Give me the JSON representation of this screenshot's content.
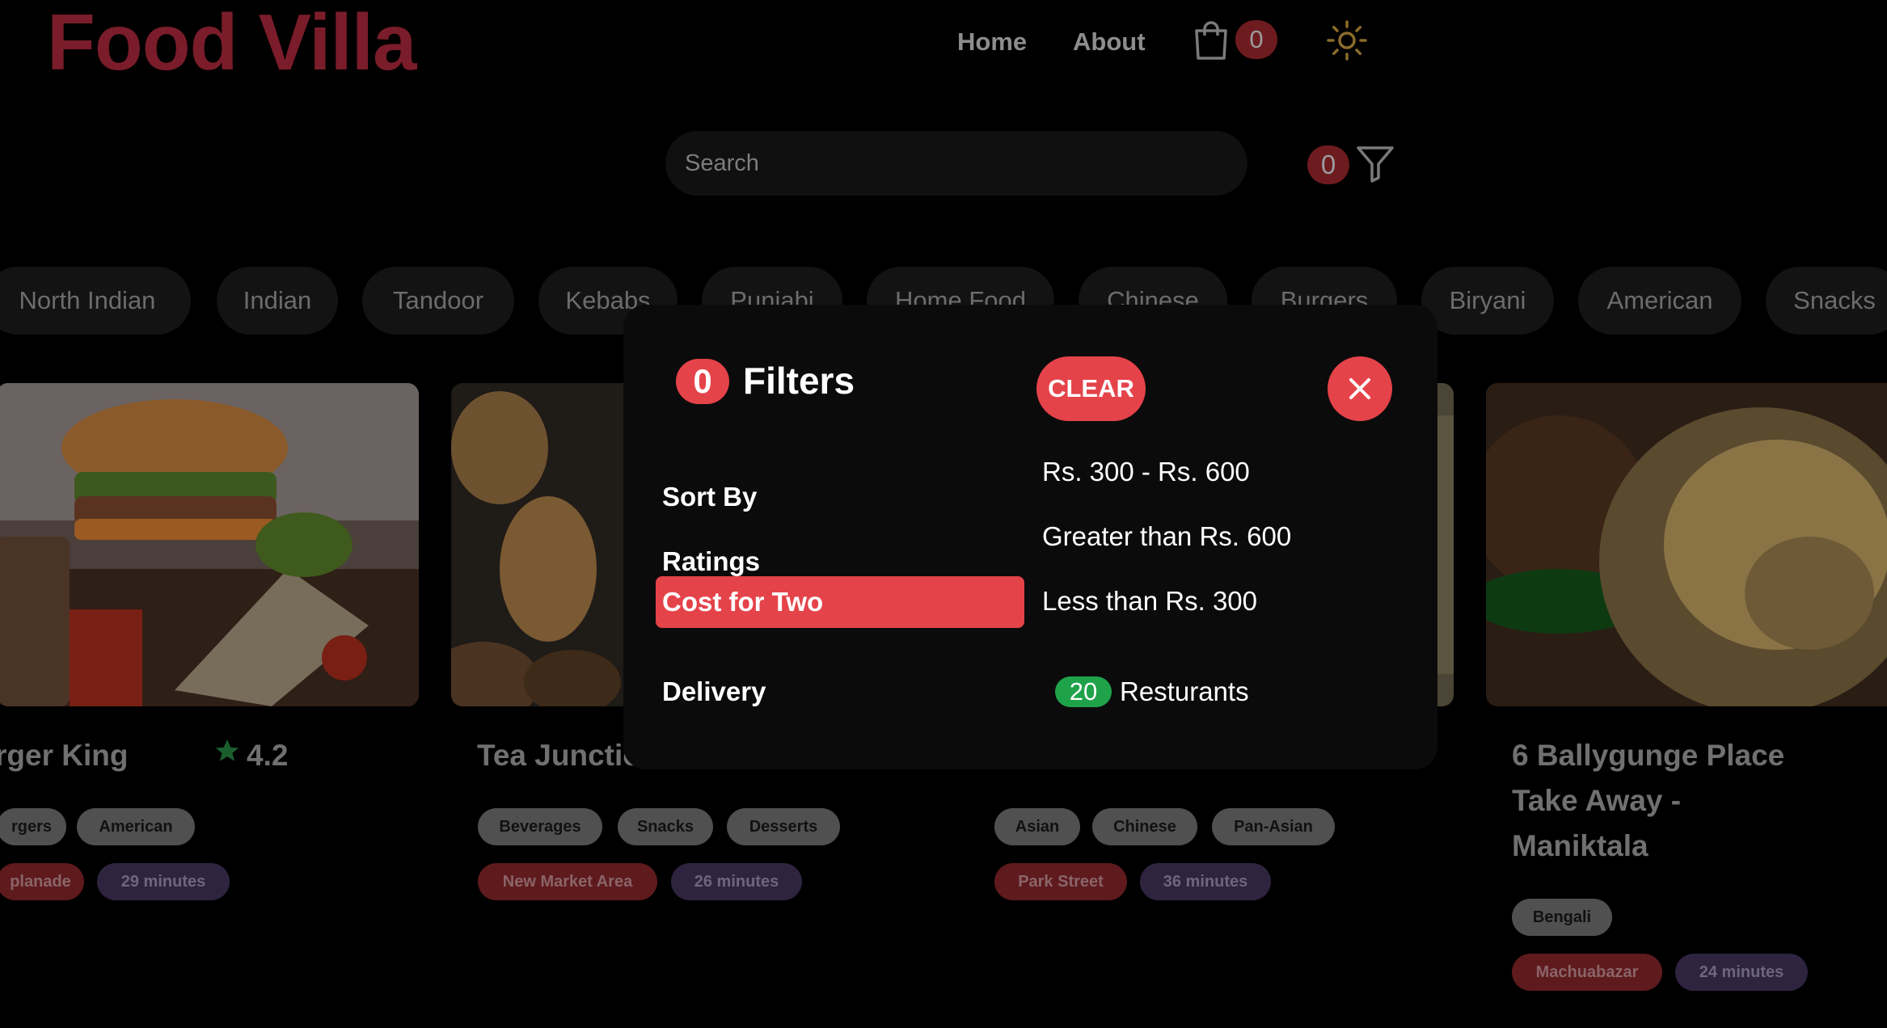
{
  "header": {
    "logo": "Food Villa",
    "nav": [
      "Home",
      "About"
    ],
    "cart_count": "0"
  },
  "search": {
    "placeholder": "Search"
  },
  "filter_count": "0",
  "cuisines": [
    "North Indian",
    "Indian",
    "Tandoor",
    "Kebabs",
    "Punjabi",
    "Home Food",
    "Chinese",
    "Burgers",
    "Biryani",
    "American",
    "Snacks"
  ],
  "cards": [
    {
      "title": "rger King",
      "rating": "4.2",
      "tags": [
        "rgers",
        "American"
      ],
      "area": "planade",
      "time": "29 minutes"
    },
    {
      "title": "Tea Junctio",
      "tags": [
        "Beverages",
        "Snacks",
        "Desserts"
      ],
      "area": "New Market Area",
      "time": "26 minutes"
    },
    {
      "tags": [
        "Asian",
        "Chinese",
        "Pan-Asian"
      ],
      "area": "Park Street",
      "time": "36 minutes"
    },
    {
      "title_lines": [
        "6 Ballygunge Place",
        "Take Away -",
        "Maniktala"
      ],
      "tags": [
        "Bengali"
      ],
      "area": "Machuabazar",
      "time": "24 minutes"
    }
  ],
  "modal": {
    "count": "0",
    "title": "Filters",
    "clear_label": "CLEAR",
    "categories": [
      "Sort By",
      "Ratings",
      "Cost for Two",
      "Delivery"
    ],
    "active_category": "Cost for Two",
    "options": [
      "Rs. 300 - Rs. 600",
      "Greater than Rs. 600",
      "Less than Rs. 300"
    ],
    "restaurant_count": "20",
    "restaurant_label": "Resturants"
  },
  "colors": {
    "accent": "#e5434a",
    "success": "#1fa34a",
    "logo": "#7a1c2a"
  }
}
